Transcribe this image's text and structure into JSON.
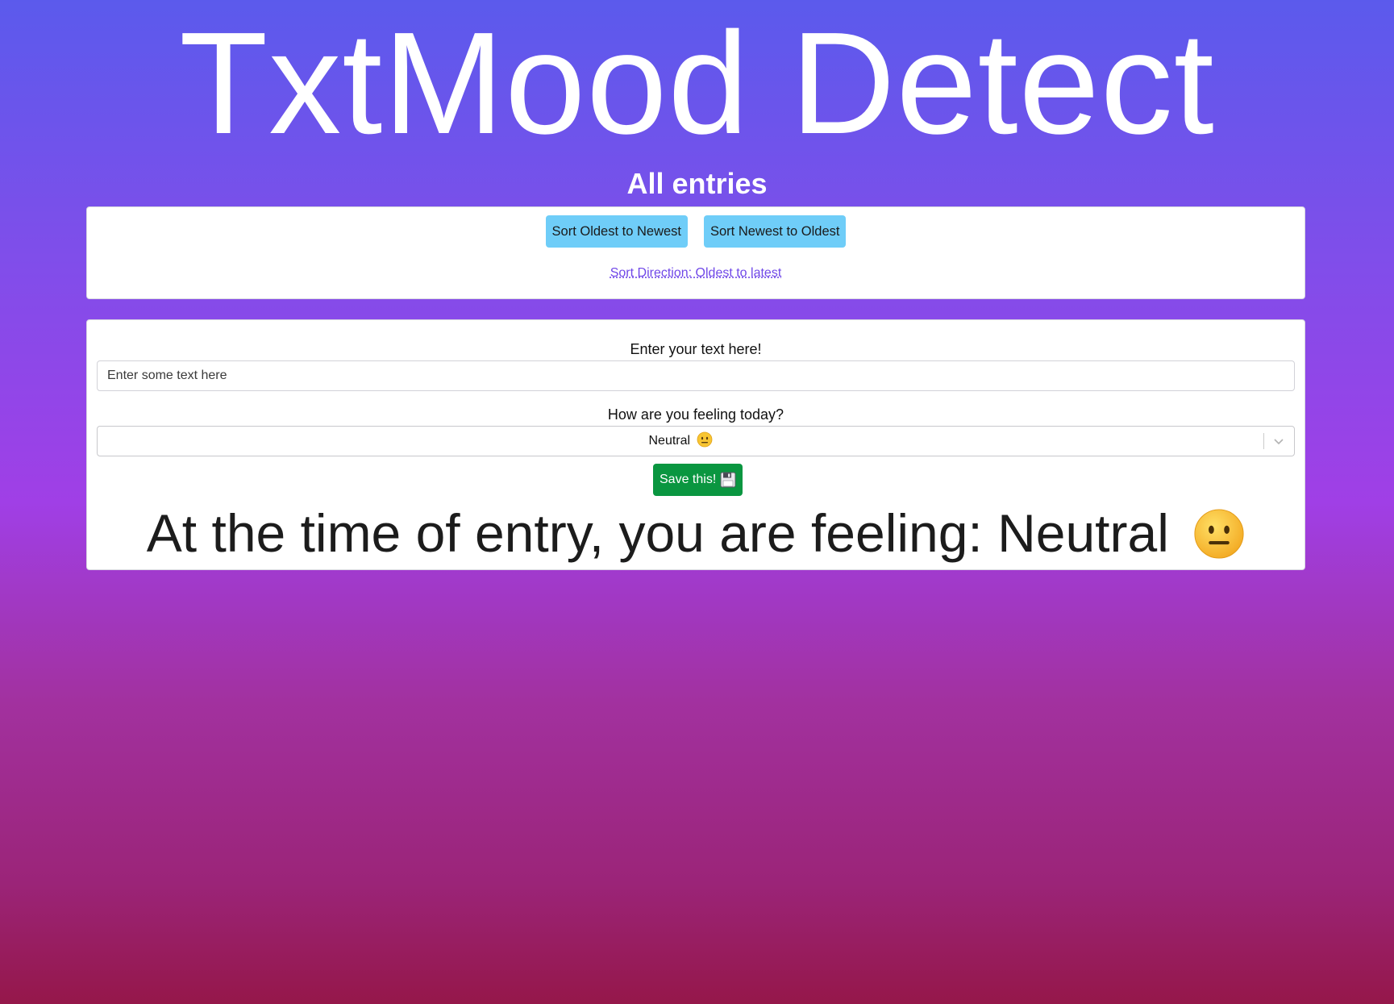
{
  "app": {
    "title": "TxtMood Detect"
  },
  "entries": {
    "section_title": "All entries"
  },
  "sort": {
    "oldest_to_newest_label": "Sort Oldest to Newest",
    "newest_to_oldest_label": "Sort Newest to Oldest",
    "direction_text": "Sort Direction: Oldest to latest"
  },
  "entry_form": {
    "text_label": "Enter your text here!",
    "text_placeholder": "Enter some text here",
    "text_value": "",
    "mood_label": "How are you feeling today?",
    "mood_selected": "Neutral",
    "mood_selected_icon": "neutral-face-icon",
    "save_label": "Save this!",
    "save_icon": "floppy-disk-icon",
    "result_text": "At the time of entry, you are feeling: Neutral",
    "result_icon": "neutral-face-icon"
  },
  "colors": {
    "background_top": "#5b5aec",
    "background_bottom": "#95174a",
    "sort_button": "#6fcdf8",
    "save_button": "#0a9640",
    "link": "#7048e8"
  }
}
